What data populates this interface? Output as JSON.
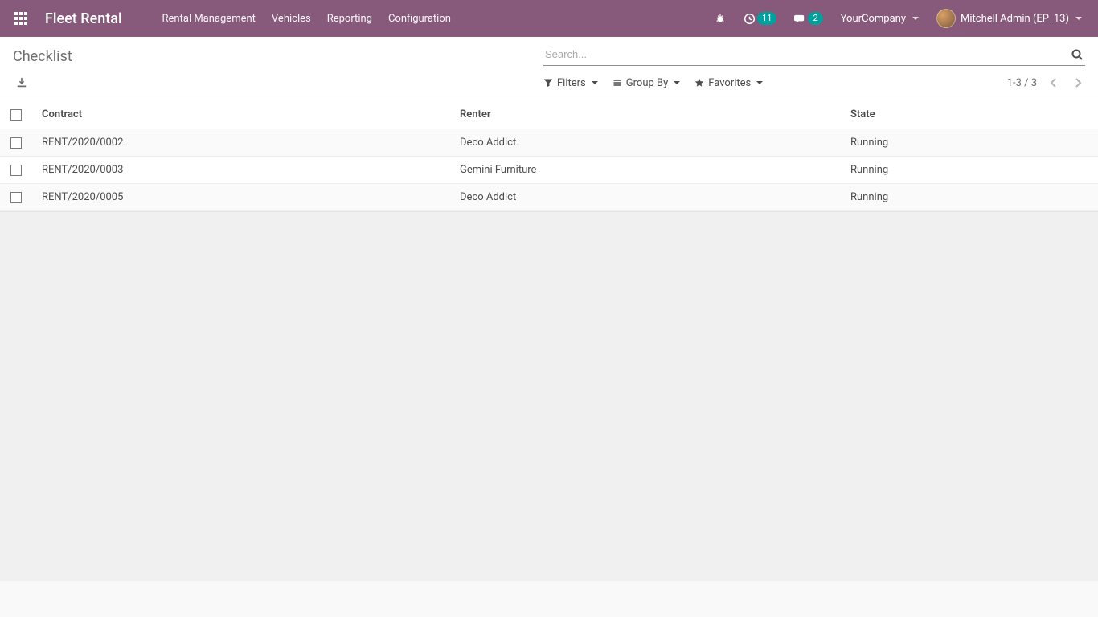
{
  "navbar": {
    "brand": "Fleet Rental",
    "menu": [
      "Rental Management",
      "Vehicles",
      "Reporting",
      "Configuration"
    ],
    "activity_badge": "11",
    "discuss_badge": "2",
    "company": "YourCompany",
    "user": "Mitchell Admin (EP_13)"
  },
  "control_panel": {
    "title": "Checklist",
    "search_placeholder": "Search...",
    "filters_label": "Filters",
    "groupby_label": "Group By",
    "favorites_label": "Favorites",
    "pager": "1-3 / 3"
  },
  "table": {
    "headers": {
      "contract": "Contract",
      "renter": "Renter",
      "state": "State"
    },
    "rows": [
      {
        "contract": "RENT/2020/0002",
        "renter": "Deco Addict",
        "state": "Running"
      },
      {
        "contract": "RENT/2020/0003",
        "renter": "Gemini Furniture",
        "state": "Running"
      },
      {
        "contract": "RENT/2020/0005",
        "renter": "Deco Addict",
        "state": "Running"
      }
    ]
  }
}
